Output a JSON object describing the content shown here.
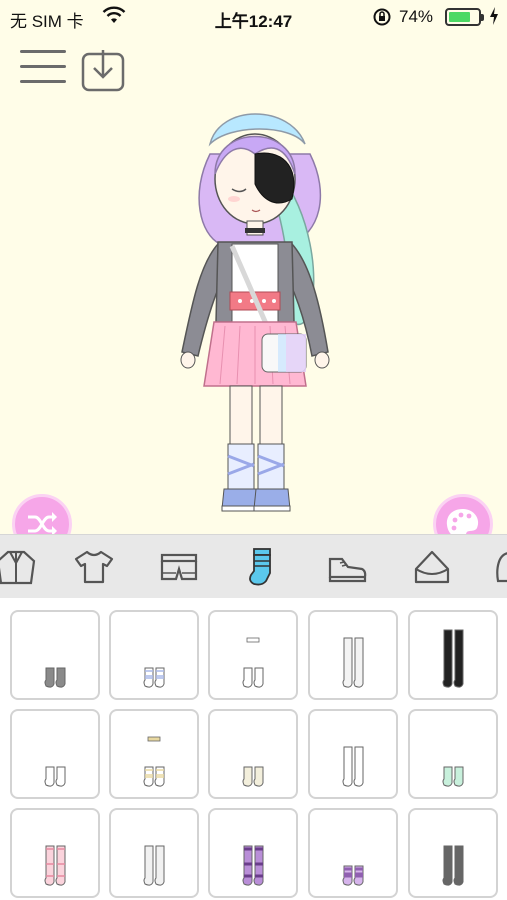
{
  "status_bar": {
    "carrier": "无 SIM 卡",
    "time": "上午12:47",
    "battery_percent": "74%",
    "battery_level": 0.74
  },
  "toolbar": {
    "menu_icon": "hamburger-menu-icon",
    "download_icon": "download-icon"
  },
  "stage": {
    "background": "#fffde8",
    "shuffle_icon": "shuffle-icon",
    "palette_icon": "palette-icon",
    "button_color": "#f6a6e8"
  },
  "category_tabs": [
    {
      "name": "jacket",
      "icon": "jacket-icon",
      "selected": false
    },
    {
      "name": "top",
      "icon": "tshirt-icon",
      "selected": false
    },
    {
      "name": "bottoms",
      "icon": "shorts-icon",
      "selected": false
    },
    {
      "name": "socks",
      "icon": "sock-icon",
      "selected": true
    },
    {
      "name": "shoes",
      "icon": "shoe-icon",
      "selected": false
    },
    {
      "name": "bag",
      "icon": "bag-icon",
      "selected": false
    },
    {
      "name": "more",
      "icon": "accessory-icon",
      "selected": false
    }
  ],
  "sock_items": [
    {
      "style": "ankle",
      "color": "#8a8a8a"
    },
    {
      "style": "ankle-ribbon",
      "color": "#ffffff",
      "accent": "#a9b8e8"
    },
    {
      "style": "ankle-bow",
      "color": "#ffffff"
    },
    {
      "style": "over-knee",
      "color": "#f4f4f4"
    },
    {
      "style": "thigh-high",
      "color": "#222222"
    },
    {
      "style": "ankle",
      "color": "#ffffff"
    },
    {
      "style": "ankle-bow",
      "color": "#ffffff",
      "accent": "#e8d8a0"
    },
    {
      "style": "ankle",
      "color": "#f3efdc"
    },
    {
      "style": "knee",
      "color": "#ffffff"
    },
    {
      "style": "ankle",
      "color": "#c8f0dc"
    },
    {
      "style": "knee-dots",
      "color": "#fbd3dc",
      "accent": "#e68aa0"
    },
    {
      "style": "knee-lace",
      "color": "#f1f1f1"
    },
    {
      "style": "knee-stripe",
      "color": "#b98ed8",
      "accent": "#6a3e8a"
    },
    {
      "style": "ankle-stripe",
      "color": "#d6b4ec",
      "accent": "#9060b0"
    },
    {
      "style": "knee",
      "color": "#666666"
    }
  ]
}
